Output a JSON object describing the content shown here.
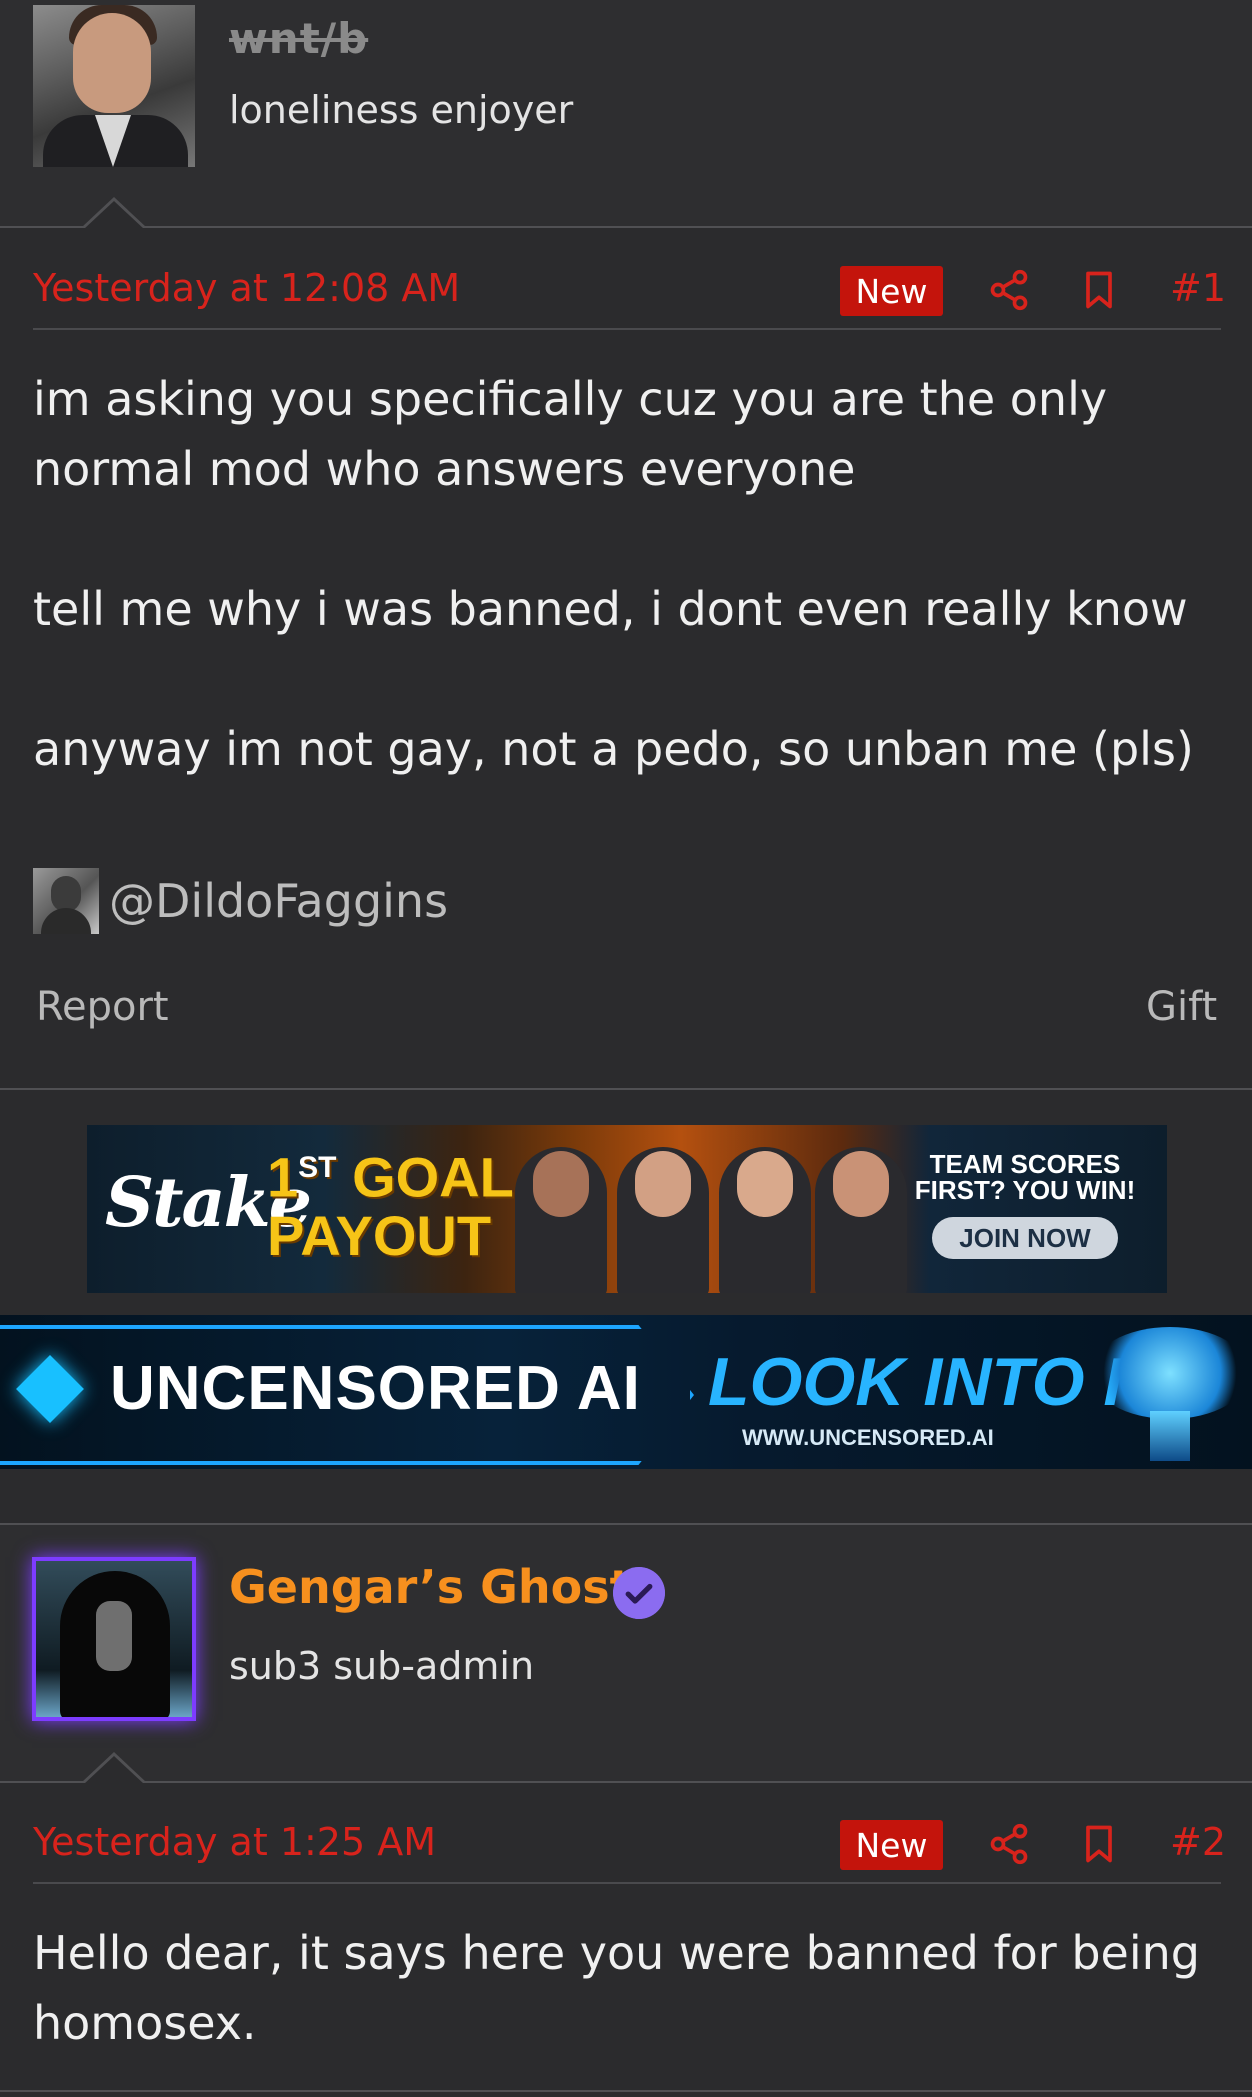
{
  "post1": {
    "username": "wnt/b",
    "user_title": "loneliness enjoyer",
    "date": "Yesterday at 12:08 AM",
    "badge": "New",
    "post_number": "#1",
    "body": "im asking you specifically cuz you are the only normal mod who answers everyone\n\ntell me why i was banned, i dont even really know\n\nanyway im not gay, not a pedo, so unban me (pls)",
    "mention": "@DildoFaggins",
    "report_label": "Report",
    "gift_label": "Gift"
  },
  "ads": {
    "stake": {
      "brand": "Stake",
      "headline_1": "1",
      "headline_sup": "ST",
      "headline_2": "GOAL",
      "headline_3": "PAYOUT",
      "tagline": "TEAM SCORES FIRST? YOU WIN!",
      "cta": "JOIN NOW"
    },
    "uncensored_ai": {
      "brand": "UNCENSORED AI",
      "cta": "LOOK INTO IT",
      "url": "WWW.UNCENSORED.AI"
    }
  },
  "post2": {
    "username": "Gengar’s Ghost",
    "user_title": "sub3 sub-admin",
    "date": "Yesterday at 1:25 AM",
    "badge": "New",
    "post_number": "#2",
    "body": "Hello dear, it says here you were banned for being homosex."
  },
  "colors": {
    "accent_red": "#d8231c",
    "badge_red": "#c4140c",
    "username_orange": "#f7901e",
    "verified_purple": "#8b6cf0",
    "background": "#2b2b2d"
  },
  "icons": [
    "share-icon",
    "bookmark-icon",
    "verified-check-icon"
  ]
}
